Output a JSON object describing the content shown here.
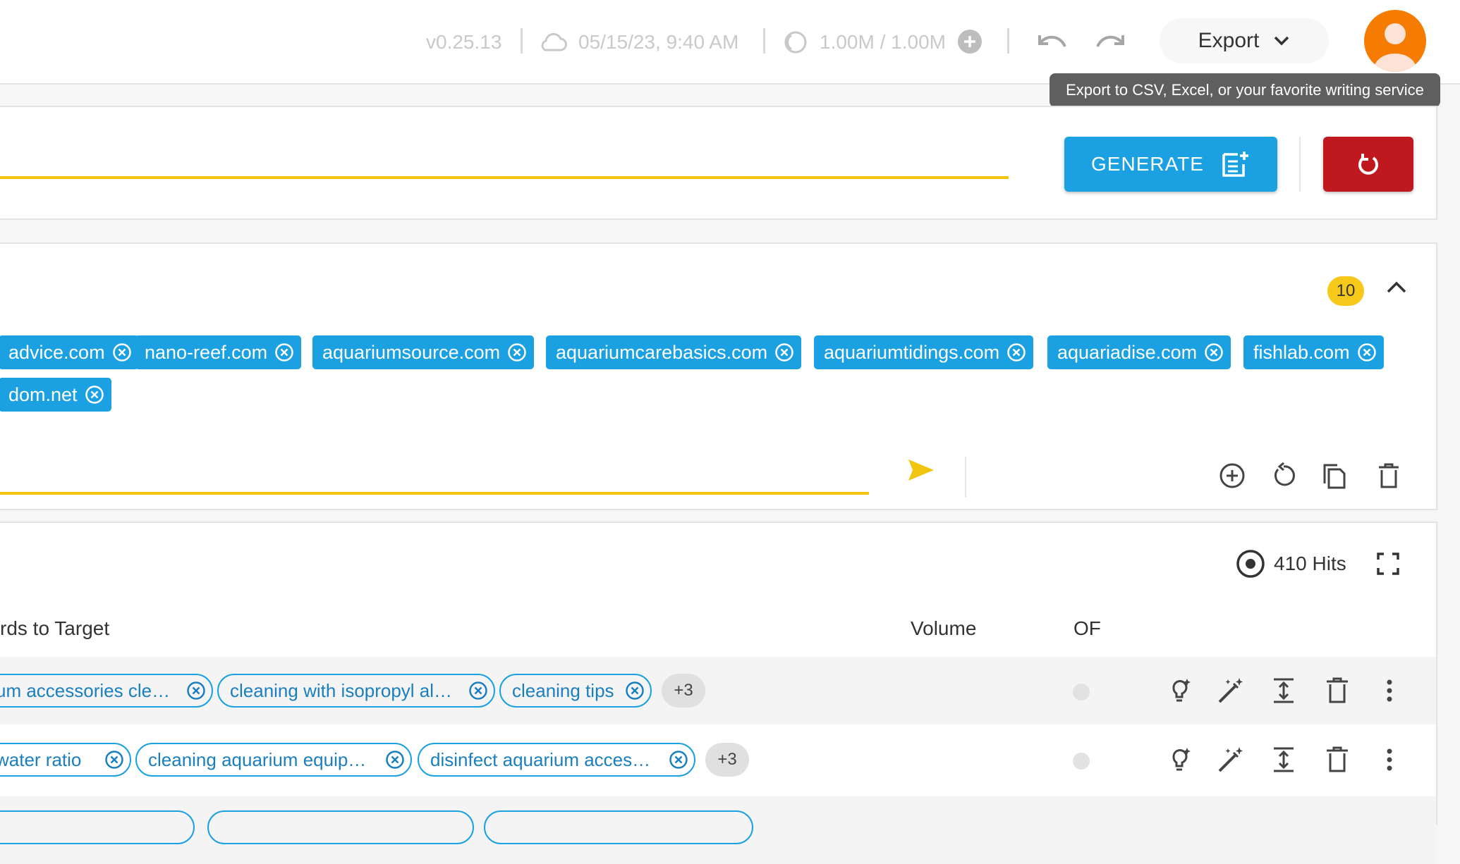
{
  "topbar": {
    "version": "v0.25.13",
    "saved_at": "05/15/23, 9:40 AM",
    "credits": "1.00M / 1.00M",
    "export_label": "Export",
    "tooltip": "Export to CSV, Excel, or your favorite writing service"
  },
  "generate": {
    "label": "GENERATE"
  },
  "competitors": {
    "count": "10",
    "chips": [
      "advice.com",
      "nano-reef.com",
      "aquariumsource.com",
      "aquariumcarebasics.com",
      "aquariumtidings.com",
      "aquariadise.com",
      "fishlab.com",
      "dom.net"
    ]
  },
  "table": {
    "hits": "410 Hits",
    "headers": {
      "keywords": "rds to Target",
      "volume": "Volume",
      "of": "OF"
    },
    "rows": [
      {
        "chips": [
          "um accessories cle…",
          "cleaning with isopropyl al…",
          "cleaning tips"
        ],
        "more": "+3"
      },
      {
        "chips": [
          "water ratio",
          "cleaning aquarium equip…",
          "disinfect aquarium acces…"
        ],
        "more": "+3"
      }
    ]
  },
  "colors": {
    "accent": "#1ba1e2",
    "danger": "#c0181f",
    "highlight": "#f1c40f",
    "avatar": "#f57c00",
    "badge": "#f6c819"
  },
  "icons": [
    "cloud-icon",
    "credits-icon",
    "add-credits-icon",
    "undo-icon",
    "redo-icon",
    "chevron-down-icon",
    "avatar-icon",
    "generate-doc-icon",
    "refresh-icon",
    "chevron-up-icon",
    "close-circle-icon",
    "send-icon",
    "add-circle-icon",
    "reset-icon",
    "copy-icon",
    "delete-icon",
    "target-icon",
    "fullscreen-icon",
    "lightbulb-icon",
    "magic-wand-icon",
    "expand-icon",
    "more-vert-icon"
  ]
}
